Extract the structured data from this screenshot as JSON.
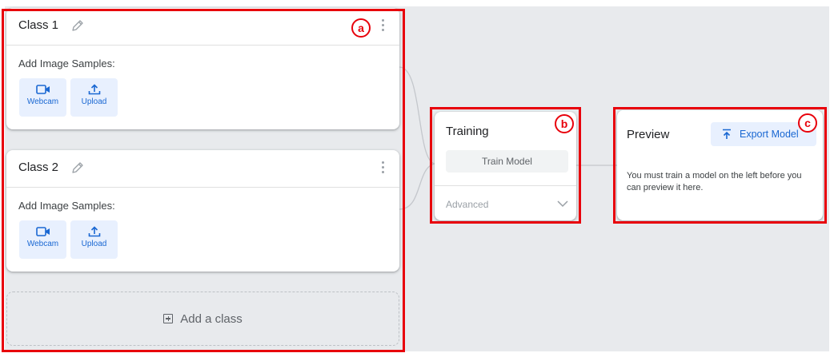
{
  "classes": [
    {
      "title": "Class 1",
      "samples_label": "Add Image Samples:",
      "webcam_label": "Webcam",
      "upload_label": "Upload"
    },
    {
      "title": "Class 2",
      "samples_label": "Add Image Samples:",
      "webcam_label": "Webcam",
      "upload_label": "Upload"
    }
  ],
  "add_class_label": "Add a class",
  "training": {
    "title": "Training",
    "train_button": "Train Model",
    "advanced_label": "Advanced"
  },
  "preview": {
    "title": "Preview",
    "export_button": "Export Model",
    "message": "You must train a model on the left before you can preview it here."
  },
  "annotations": {
    "a": "a",
    "b": "b",
    "c": "c"
  },
  "colors": {
    "highlight": "#e8000b",
    "accent": "#1967d2",
    "button_bg": "#e8f0fe",
    "workspace_bg": "#e8eaed"
  },
  "icons": [
    "pencil-icon",
    "more-vert-icon",
    "videocam-icon",
    "upload-icon",
    "add-box-icon",
    "chevron-down-icon",
    "export-icon"
  ]
}
